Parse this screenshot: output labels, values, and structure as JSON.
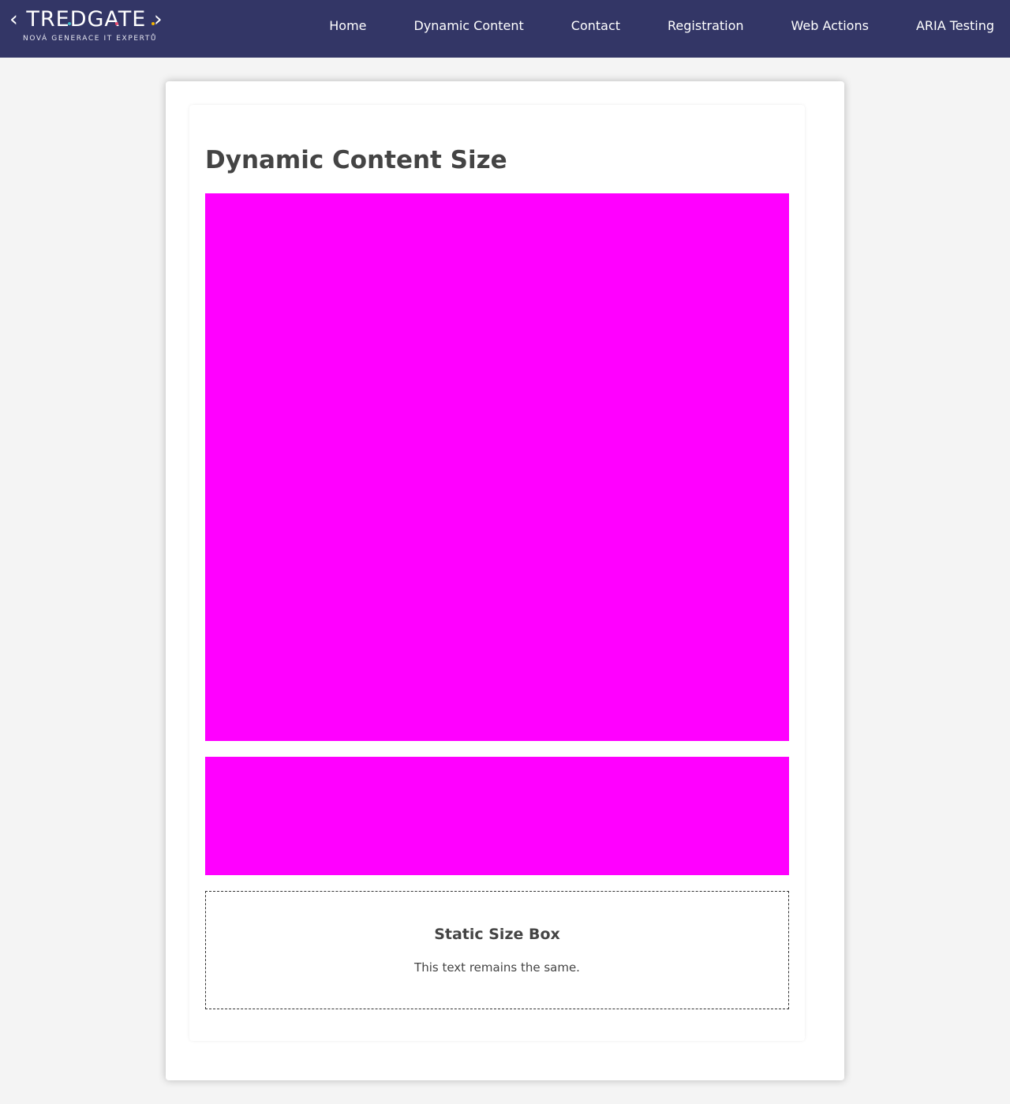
{
  "header": {
    "logo": {
      "name": "TREDGATE",
      "tagline": "NOVÁ GENERACE IT EXPERTŮ"
    },
    "nav": [
      {
        "label": "Home"
      },
      {
        "label": "Dynamic Content"
      },
      {
        "label": "Contact"
      },
      {
        "label": "Registration"
      },
      {
        "label": "Web Actions"
      },
      {
        "label": "ARIA Testing"
      }
    ]
  },
  "main": {
    "title": "Dynamic Content Size",
    "static_box": {
      "title": "Static Size Box",
      "text": "This text remains the same."
    }
  },
  "colors": {
    "navbar": "#333666",
    "dynamic_box": "#ff00ff",
    "page_background": "#f4f4f4",
    "logo_dots": [
      "#3fb8c7",
      "#e94b6f",
      "#f4b400"
    ]
  }
}
